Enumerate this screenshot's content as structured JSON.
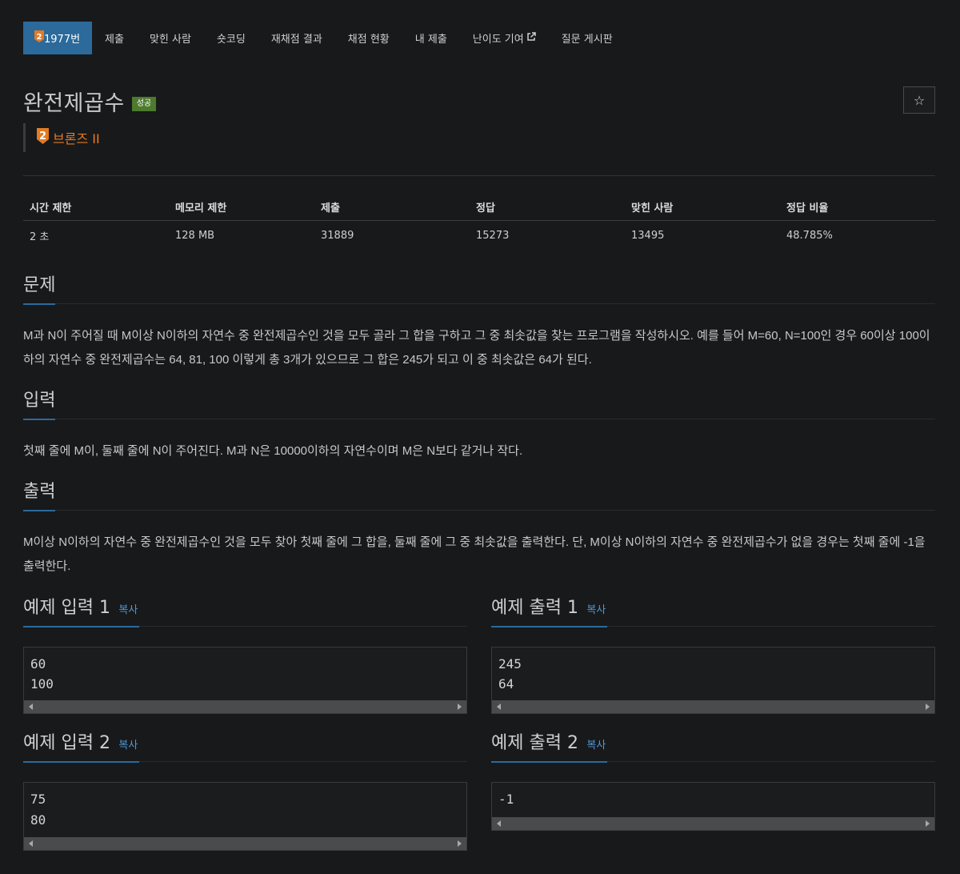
{
  "nav": {
    "items": [
      {
        "label": "1977번",
        "active": true
      },
      {
        "label": "제출"
      },
      {
        "label": "맞힌 사람"
      },
      {
        "label": "숏코딩"
      },
      {
        "label": "재채점 결과"
      },
      {
        "label": "채점 현황"
      },
      {
        "label": "내 제출"
      },
      {
        "label": "난이도 기여"
      },
      {
        "label": "질문 게시판"
      }
    ]
  },
  "problem": {
    "title": "완전제곱수",
    "status_badge": "성공",
    "tier_number": "2",
    "tier_name": "브론즈 II",
    "tier_color": "#e27b23"
  },
  "info_table": {
    "headers": [
      "시간 제한",
      "메모리 제한",
      "제출",
      "정답",
      "맞힌 사람",
      "정답 비율"
    ],
    "values": [
      "2 초",
      "128 MB",
      "31889",
      "15273",
      "13495",
      "48.785%"
    ]
  },
  "sections": {
    "problem": {
      "title": "문제",
      "text": "M과 N이 주어질 때 M이상 N이하의 자연수 중 완전제곱수인 것을 모두 골라 그 합을 구하고 그 중 최솟값을 찾는 프로그램을 작성하시오. 예를 들어 M=60, N=100인 경우 60이상 100이하의 자연수 중 완전제곱수는 64, 81, 100 이렇게 총 3개가 있으므로 그 합은 245가 되고 이 중 최솟값은 64가 된다."
    },
    "input": {
      "title": "입력",
      "text": "첫째 줄에 M이, 둘째 줄에 N이 주어진다. M과 N은 10000이하의 자연수이며 M은 N보다 같거나 작다."
    },
    "output": {
      "title": "출력",
      "text": "M이상 N이하의 자연수 중 완전제곱수인 것을 모두 찾아 첫째 줄에 그 합을, 둘째 줄에 그 중 최솟값을 출력한다. 단, M이상 N이하의 자연수 중 완전제곱수가 없을 경우는 첫째 줄에 -1을 출력한다."
    }
  },
  "samples": {
    "copy_label": "복사",
    "input1": {
      "title": "예제 입력 1",
      "content": "60\n100"
    },
    "output1": {
      "title": "예제 출력 1",
      "content": "245\n64"
    },
    "input2": {
      "title": "예제 입력 2",
      "content": "75\n80"
    },
    "output2": {
      "title": "예제 출력 2",
      "content": "-1"
    }
  },
  "icons": {
    "star": "☆",
    "external_link": "external-link-icon"
  },
  "colors": {
    "accent": "#2b6a9b",
    "success": "#4d7a2d",
    "link": "#4f97d3",
    "bronze": "#e27b23"
  }
}
